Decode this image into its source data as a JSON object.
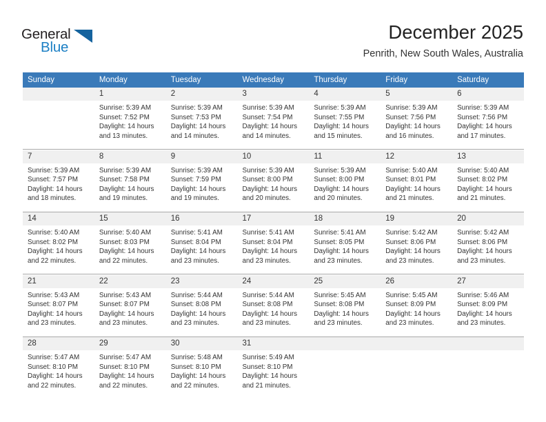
{
  "brand": {
    "name_top": "General",
    "name_bottom": "Blue",
    "accent_color": "#15639e",
    "blue_text_color": "#1b7fc4"
  },
  "header": {
    "title": "December 2025",
    "subtitle": "Penrith, New South Wales, Australia",
    "header_bg_color": "#3a7ab9",
    "daynum_bg_color": "#f0f0f0"
  },
  "weekday_headers": [
    "Sunday",
    "Monday",
    "Tuesday",
    "Wednesday",
    "Thursday",
    "Friday",
    "Saturday"
  ],
  "weeks": [
    [
      {
        "day": "",
        "sunrise": "",
        "sunset": "",
        "daylight1": "",
        "daylight2": ""
      },
      {
        "day": "1",
        "sunrise": "Sunrise: 5:39 AM",
        "sunset": "Sunset: 7:52 PM",
        "daylight1": "Daylight: 14 hours",
        "daylight2": "and 13 minutes."
      },
      {
        "day": "2",
        "sunrise": "Sunrise: 5:39 AM",
        "sunset": "Sunset: 7:53 PM",
        "daylight1": "Daylight: 14 hours",
        "daylight2": "and 14 minutes."
      },
      {
        "day": "3",
        "sunrise": "Sunrise: 5:39 AM",
        "sunset": "Sunset: 7:54 PM",
        "daylight1": "Daylight: 14 hours",
        "daylight2": "and 14 minutes."
      },
      {
        "day": "4",
        "sunrise": "Sunrise: 5:39 AM",
        "sunset": "Sunset: 7:55 PM",
        "daylight1": "Daylight: 14 hours",
        "daylight2": "and 15 minutes."
      },
      {
        "day": "5",
        "sunrise": "Sunrise: 5:39 AM",
        "sunset": "Sunset: 7:56 PM",
        "daylight1": "Daylight: 14 hours",
        "daylight2": "and 16 minutes."
      },
      {
        "day": "6",
        "sunrise": "Sunrise: 5:39 AM",
        "sunset": "Sunset: 7:56 PM",
        "daylight1": "Daylight: 14 hours",
        "daylight2": "and 17 minutes."
      }
    ],
    [
      {
        "day": "7",
        "sunrise": "Sunrise: 5:39 AM",
        "sunset": "Sunset: 7:57 PM",
        "daylight1": "Daylight: 14 hours",
        "daylight2": "and 18 minutes."
      },
      {
        "day": "8",
        "sunrise": "Sunrise: 5:39 AM",
        "sunset": "Sunset: 7:58 PM",
        "daylight1": "Daylight: 14 hours",
        "daylight2": "and 19 minutes."
      },
      {
        "day": "9",
        "sunrise": "Sunrise: 5:39 AM",
        "sunset": "Sunset: 7:59 PM",
        "daylight1": "Daylight: 14 hours",
        "daylight2": "and 19 minutes."
      },
      {
        "day": "10",
        "sunrise": "Sunrise: 5:39 AM",
        "sunset": "Sunset: 8:00 PM",
        "daylight1": "Daylight: 14 hours",
        "daylight2": "and 20 minutes."
      },
      {
        "day": "11",
        "sunrise": "Sunrise: 5:39 AM",
        "sunset": "Sunset: 8:00 PM",
        "daylight1": "Daylight: 14 hours",
        "daylight2": "and 20 minutes."
      },
      {
        "day": "12",
        "sunrise": "Sunrise: 5:40 AM",
        "sunset": "Sunset: 8:01 PM",
        "daylight1": "Daylight: 14 hours",
        "daylight2": "and 21 minutes."
      },
      {
        "day": "13",
        "sunrise": "Sunrise: 5:40 AM",
        "sunset": "Sunset: 8:02 PM",
        "daylight1": "Daylight: 14 hours",
        "daylight2": "and 21 minutes."
      }
    ],
    [
      {
        "day": "14",
        "sunrise": "Sunrise: 5:40 AM",
        "sunset": "Sunset: 8:02 PM",
        "daylight1": "Daylight: 14 hours",
        "daylight2": "and 22 minutes."
      },
      {
        "day": "15",
        "sunrise": "Sunrise: 5:40 AM",
        "sunset": "Sunset: 8:03 PM",
        "daylight1": "Daylight: 14 hours",
        "daylight2": "and 22 minutes."
      },
      {
        "day": "16",
        "sunrise": "Sunrise: 5:41 AM",
        "sunset": "Sunset: 8:04 PM",
        "daylight1": "Daylight: 14 hours",
        "daylight2": "and 23 minutes."
      },
      {
        "day": "17",
        "sunrise": "Sunrise: 5:41 AM",
        "sunset": "Sunset: 8:04 PM",
        "daylight1": "Daylight: 14 hours",
        "daylight2": "and 23 minutes."
      },
      {
        "day": "18",
        "sunrise": "Sunrise: 5:41 AM",
        "sunset": "Sunset: 8:05 PM",
        "daylight1": "Daylight: 14 hours",
        "daylight2": "and 23 minutes."
      },
      {
        "day": "19",
        "sunrise": "Sunrise: 5:42 AM",
        "sunset": "Sunset: 8:06 PM",
        "daylight1": "Daylight: 14 hours",
        "daylight2": "and 23 minutes."
      },
      {
        "day": "20",
        "sunrise": "Sunrise: 5:42 AM",
        "sunset": "Sunset: 8:06 PM",
        "daylight1": "Daylight: 14 hours",
        "daylight2": "and 23 minutes."
      }
    ],
    [
      {
        "day": "21",
        "sunrise": "Sunrise: 5:43 AM",
        "sunset": "Sunset: 8:07 PM",
        "daylight1": "Daylight: 14 hours",
        "daylight2": "and 23 minutes."
      },
      {
        "day": "22",
        "sunrise": "Sunrise: 5:43 AM",
        "sunset": "Sunset: 8:07 PM",
        "daylight1": "Daylight: 14 hours",
        "daylight2": "and 23 minutes."
      },
      {
        "day": "23",
        "sunrise": "Sunrise: 5:44 AM",
        "sunset": "Sunset: 8:08 PM",
        "daylight1": "Daylight: 14 hours",
        "daylight2": "and 23 minutes."
      },
      {
        "day": "24",
        "sunrise": "Sunrise: 5:44 AM",
        "sunset": "Sunset: 8:08 PM",
        "daylight1": "Daylight: 14 hours",
        "daylight2": "and 23 minutes."
      },
      {
        "day": "25",
        "sunrise": "Sunrise: 5:45 AM",
        "sunset": "Sunset: 8:08 PM",
        "daylight1": "Daylight: 14 hours",
        "daylight2": "and 23 minutes."
      },
      {
        "day": "26",
        "sunrise": "Sunrise: 5:45 AM",
        "sunset": "Sunset: 8:09 PM",
        "daylight1": "Daylight: 14 hours",
        "daylight2": "and 23 minutes."
      },
      {
        "day": "27",
        "sunrise": "Sunrise: 5:46 AM",
        "sunset": "Sunset: 8:09 PM",
        "daylight1": "Daylight: 14 hours",
        "daylight2": "and 23 minutes."
      }
    ],
    [
      {
        "day": "28",
        "sunrise": "Sunrise: 5:47 AM",
        "sunset": "Sunset: 8:10 PM",
        "daylight1": "Daylight: 14 hours",
        "daylight2": "and 22 minutes."
      },
      {
        "day": "29",
        "sunrise": "Sunrise: 5:47 AM",
        "sunset": "Sunset: 8:10 PM",
        "daylight1": "Daylight: 14 hours",
        "daylight2": "and 22 minutes."
      },
      {
        "day": "30",
        "sunrise": "Sunrise: 5:48 AM",
        "sunset": "Sunset: 8:10 PM",
        "daylight1": "Daylight: 14 hours",
        "daylight2": "and 22 minutes."
      },
      {
        "day": "31",
        "sunrise": "Sunrise: 5:49 AM",
        "sunset": "Sunset: 8:10 PM",
        "daylight1": "Daylight: 14 hours",
        "daylight2": "and 21 minutes."
      },
      {
        "day": "",
        "sunrise": "",
        "sunset": "",
        "daylight1": "",
        "daylight2": ""
      },
      {
        "day": "",
        "sunrise": "",
        "sunset": "",
        "daylight1": "",
        "daylight2": ""
      },
      {
        "day": "",
        "sunrise": "",
        "sunset": "",
        "daylight1": "",
        "daylight2": ""
      }
    ]
  ]
}
